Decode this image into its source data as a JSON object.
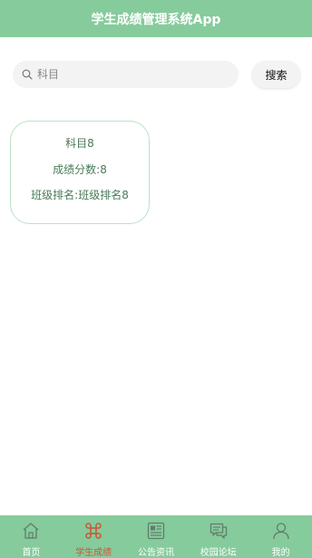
{
  "header": {
    "title": "学生成绩管理系统App"
  },
  "search": {
    "placeholder": "科目",
    "value": "",
    "button_label": "搜索"
  },
  "cards": [
    {
      "subject": "科目8",
      "score": "成绩分数:8",
      "rank": "班级排名:班级排名8"
    }
  ],
  "tabbar": {
    "items": [
      {
        "label": "首页",
        "icon": "home-icon",
        "active": false
      },
      {
        "label": "学生成绩",
        "icon": "command-icon",
        "active": true
      },
      {
        "label": "公告资讯",
        "icon": "news-icon",
        "active": false
      },
      {
        "label": "校园论坛",
        "icon": "chat-icon",
        "active": false
      },
      {
        "label": "我的",
        "icon": "user-icon",
        "active": false
      }
    ]
  },
  "colors": {
    "accent": "#86cb9c",
    "active_tab": "#c55a3a",
    "card_border": "#b9e3c4",
    "card_text": "#4a7a58"
  }
}
